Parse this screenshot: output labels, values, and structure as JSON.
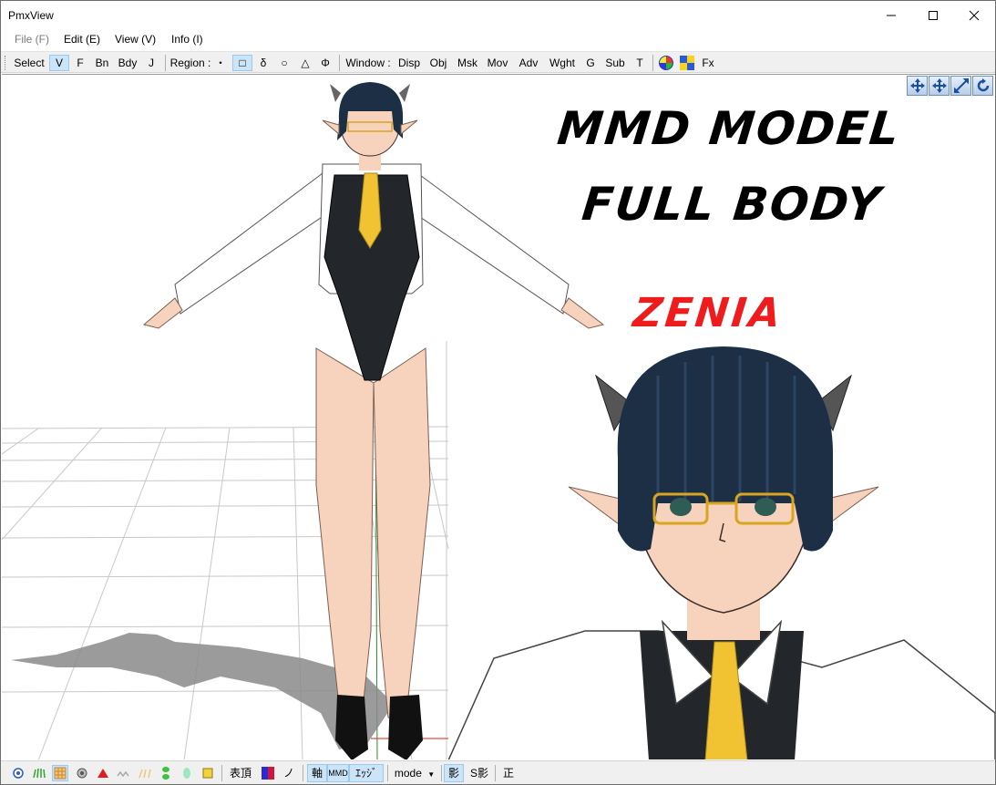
{
  "window": {
    "title": "PmxView"
  },
  "menu": {
    "items": [
      {
        "label": "File (F)",
        "enabled": false
      },
      {
        "label": "Edit (E)",
        "enabled": true
      },
      {
        "label": "View (V)",
        "enabled": true
      },
      {
        "label": "Info (I)",
        "enabled": true
      }
    ]
  },
  "toolbar": {
    "select_label": "Select :",
    "select_items": [
      "V",
      "F",
      "Bn",
      "Bdy",
      "J"
    ],
    "select_active": "V",
    "region_label": "Region :",
    "region_items": [
      "・",
      "□",
      "δ",
      "○",
      "△",
      "Φ"
    ],
    "region_active": "□",
    "window_label": "Window :",
    "window_items": [
      "Disp",
      "Obj",
      "Msk",
      "Mov",
      "Adv",
      "Wght",
      "G",
      "Sub",
      "T"
    ],
    "fx_label": "Fx"
  },
  "viewport": {
    "heading_line1": "MMD MODEL",
    "heading_line2": "FULL BODY",
    "model_name": "ZENIA",
    "accent_color": "#ee1c1c",
    "nav_icons": [
      "move-xy-icon",
      "move-xz-icon",
      "zoom-icon",
      "rotate-icon"
    ]
  },
  "statusbar": {
    "expression_label": "表頂",
    "nomi_label": "ノミ",
    "axis_label": "軸",
    "mmd_label": "MMD",
    "edge_label": "ｴｯｼﾞ",
    "mode_label": "mode",
    "shadow_label": "影",
    "sshadow_label": "S影",
    "correct_label": "正"
  }
}
